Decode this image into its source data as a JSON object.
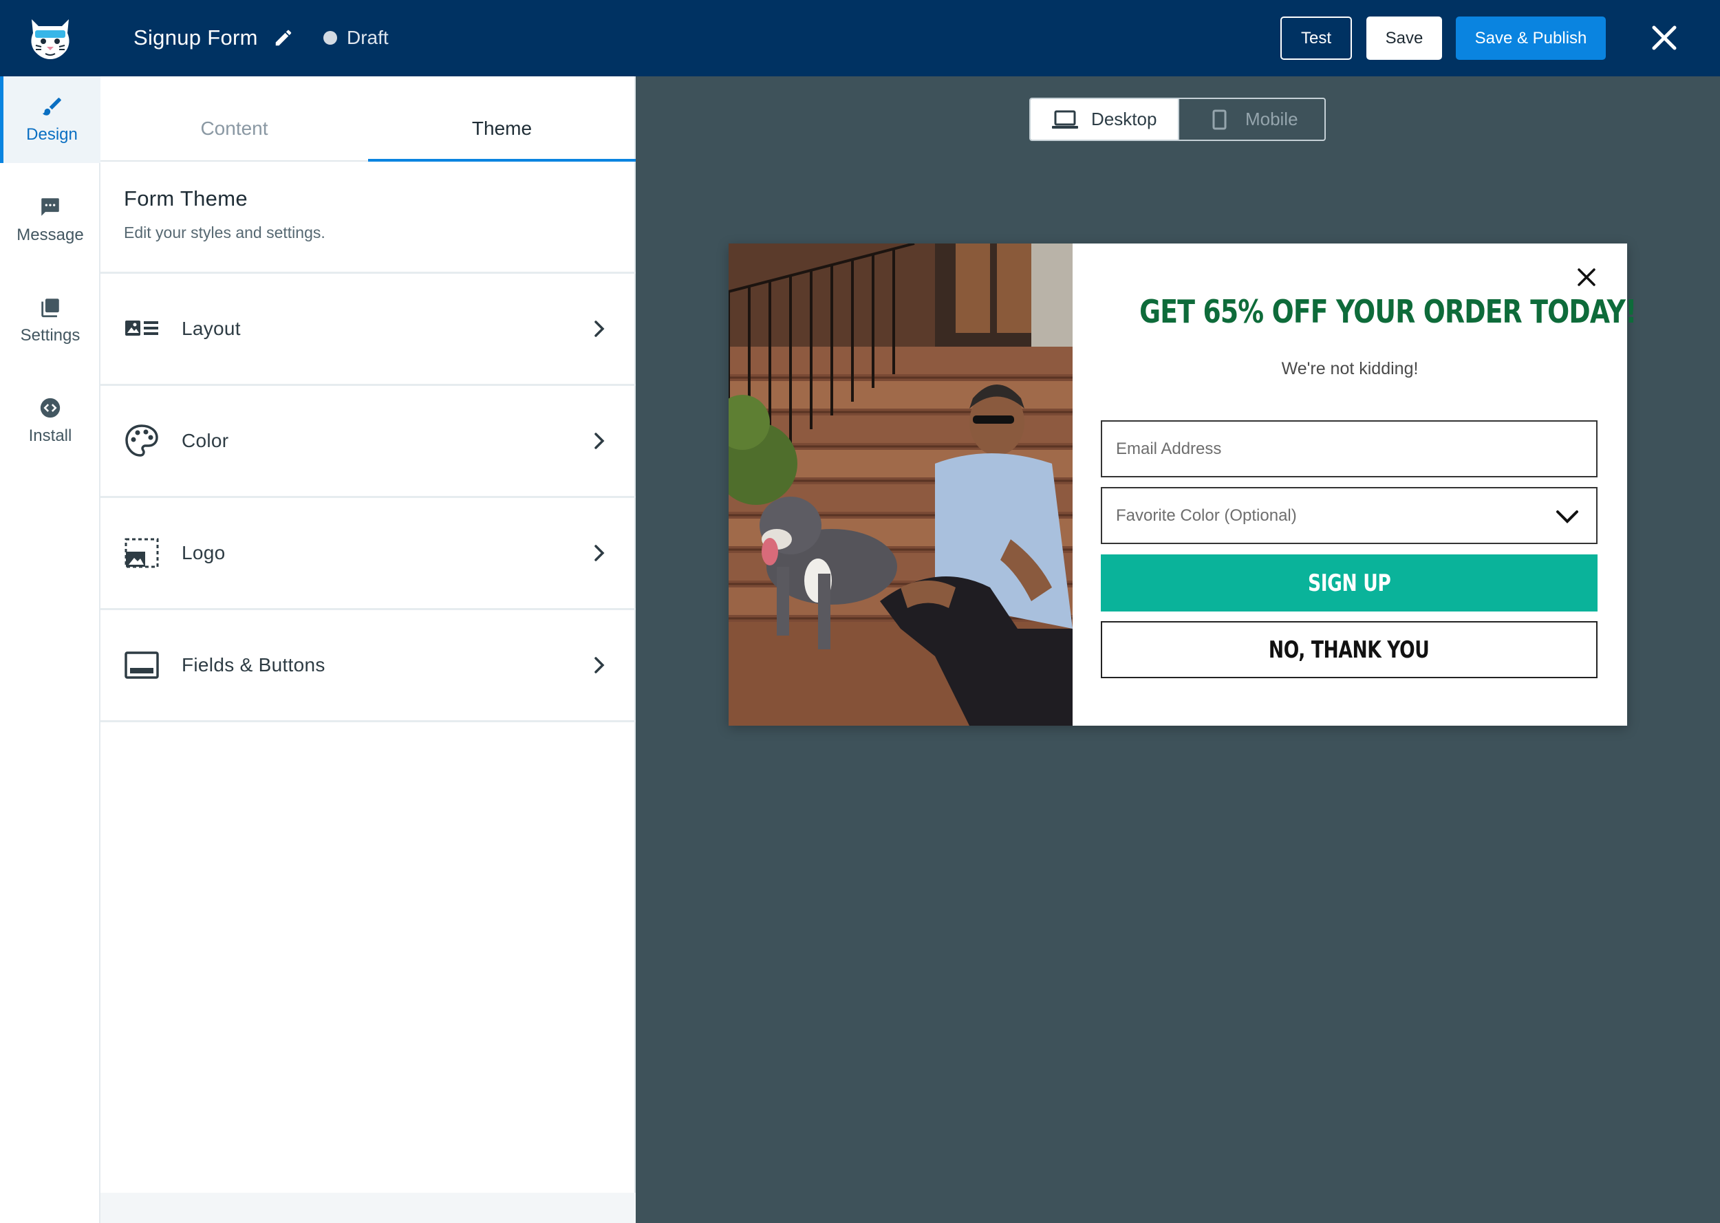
{
  "app": {
    "form_title": "Signup Form",
    "status": "Draft"
  },
  "toolbar": {
    "test_label": "Test",
    "save_label": "Save",
    "publish_label": "Save & Publish"
  },
  "nav": {
    "items": [
      {
        "label": "Design",
        "icon": "brush-icon",
        "active": true
      },
      {
        "label": "Message",
        "icon": "message-icon",
        "active": false
      },
      {
        "label": "Settings",
        "icon": "settings-icon",
        "active": false
      },
      {
        "label": "Install",
        "icon": "code-icon",
        "active": false
      }
    ]
  },
  "panel": {
    "tabs": [
      {
        "label": "Content",
        "active": false
      },
      {
        "label": "Theme",
        "active": true
      }
    ],
    "heading": "Form Theme",
    "subheading": "Edit your styles and settings.",
    "rows": [
      {
        "label": "Layout",
        "icon": "layout-icon"
      },
      {
        "label": "Color",
        "icon": "palette-icon"
      },
      {
        "label": "Logo",
        "icon": "image-icon"
      },
      {
        "label": "Fields & Buttons",
        "icon": "fields-icon"
      }
    ]
  },
  "preview": {
    "devices": [
      {
        "label": "Desktop",
        "icon": "laptop-icon",
        "active": true
      },
      {
        "label": "Mobile",
        "icon": "phone-icon",
        "active": false
      }
    ],
    "popup": {
      "headline": "GET 65% OFF YOUR ORDER TODAY!",
      "subline": "We're not kidding!",
      "email_placeholder": "Email Address",
      "select_placeholder": "Favorite Color (Optional)",
      "signup_label": "SIGN UP",
      "decline_label": "NO, THANK YOU"
    }
  },
  "colors": {
    "topbar": "#003262",
    "accent": "#0a84e0",
    "headline": "#0e6b3a",
    "signup_button": "#0ab39a",
    "canvas": "#3e525a"
  }
}
